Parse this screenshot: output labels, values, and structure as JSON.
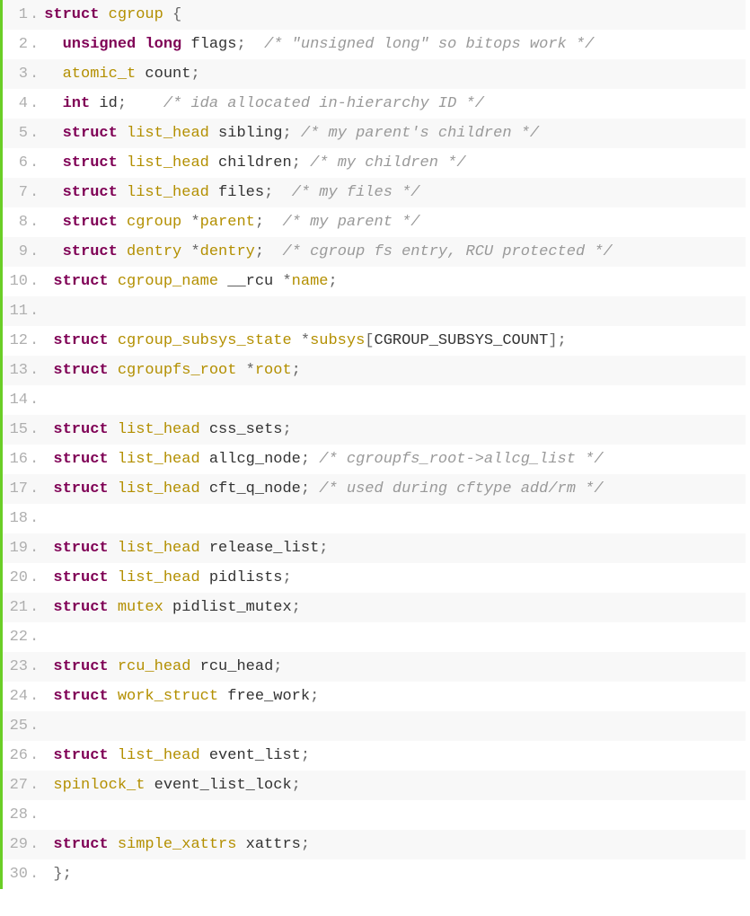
{
  "code": {
    "lines": [
      {
        "n": 1,
        "tokens": [
          {
            "t": "struct",
            "c": "kw"
          },
          {
            "t": " "
          },
          {
            "t": "cgroup",
            "c": "tname"
          },
          {
            "t": " "
          },
          {
            "t": "{",
            "c": "pun"
          }
        ]
      },
      {
        "n": 2,
        "tokens": [
          {
            "t": "  "
          },
          {
            "t": "unsigned",
            "c": "kw"
          },
          {
            "t": " "
          },
          {
            "t": "long",
            "c": "kw"
          },
          {
            "t": " flags"
          },
          {
            "t": ";",
            "c": "pun"
          },
          {
            "t": "  "
          },
          {
            "t": "/* \"unsigned long\" so bitops work */",
            "c": "cmt"
          }
        ]
      },
      {
        "n": 3,
        "tokens": [
          {
            "t": "  "
          },
          {
            "t": "atomic_t",
            "c": "tname"
          },
          {
            "t": " count"
          },
          {
            "t": ";",
            "c": "pun"
          }
        ]
      },
      {
        "n": 4,
        "tokens": [
          {
            "t": "  "
          },
          {
            "t": "int",
            "c": "kw"
          },
          {
            "t": " id"
          },
          {
            "t": ";",
            "c": "pun"
          },
          {
            "t": "    "
          },
          {
            "t": "/* ida allocated in-hierarchy ID */",
            "c": "cmt"
          }
        ]
      },
      {
        "n": 5,
        "tokens": [
          {
            "t": "  "
          },
          {
            "t": "struct",
            "c": "kw"
          },
          {
            "t": " "
          },
          {
            "t": "list_head",
            "c": "tname"
          },
          {
            "t": " sibling"
          },
          {
            "t": ";",
            "c": "pun"
          },
          {
            "t": " "
          },
          {
            "t": "/* my parent's children */",
            "c": "cmt"
          }
        ]
      },
      {
        "n": 6,
        "tokens": [
          {
            "t": "  "
          },
          {
            "t": "struct",
            "c": "kw"
          },
          {
            "t": " "
          },
          {
            "t": "list_head",
            "c": "tname"
          },
          {
            "t": " children"
          },
          {
            "t": ";",
            "c": "pun"
          },
          {
            "t": " "
          },
          {
            "t": "/* my children */",
            "c": "cmt"
          }
        ]
      },
      {
        "n": 7,
        "tokens": [
          {
            "t": "  "
          },
          {
            "t": "struct",
            "c": "kw"
          },
          {
            "t": " "
          },
          {
            "t": "list_head",
            "c": "tname"
          },
          {
            "t": " files"
          },
          {
            "t": ";",
            "c": "pun"
          },
          {
            "t": "  "
          },
          {
            "t": "/* my files */",
            "c": "cmt"
          }
        ]
      },
      {
        "n": 8,
        "tokens": [
          {
            "t": "  "
          },
          {
            "t": "struct",
            "c": "kw"
          },
          {
            "t": " "
          },
          {
            "t": "cgroup",
            "c": "tname"
          },
          {
            "t": " "
          },
          {
            "t": "*",
            "c": "pun"
          },
          {
            "t": "parent",
            "c": "tname"
          },
          {
            "t": ";",
            "c": "pun"
          },
          {
            "t": "  "
          },
          {
            "t": "/* my parent */",
            "c": "cmt"
          }
        ]
      },
      {
        "n": 9,
        "tokens": [
          {
            "t": "  "
          },
          {
            "t": "struct",
            "c": "kw"
          },
          {
            "t": " "
          },
          {
            "t": "dentry",
            "c": "tname"
          },
          {
            "t": " "
          },
          {
            "t": "*",
            "c": "pun"
          },
          {
            "t": "dentry",
            "c": "tname"
          },
          {
            "t": ";",
            "c": "pun"
          },
          {
            "t": "  "
          },
          {
            "t": "/* cgroup fs entry, RCU protected */",
            "c": "cmt"
          }
        ]
      },
      {
        "n": 10,
        "tokens": [
          {
            "t": " "
          },
          {
            "t": "struct",
            "c": "kw"
          },
          {
            "t": " "
          },
          {
            "t": "cgroup_name",
            "c": "tname"
          },
          {
            "t": " __rcu "
          },
          {
            "t": "*",
            "c": "pun"
          },
          {
            "t": "name",
            "c": "tname"
          },
          {
            "t": ";",
            "c": "pun"
          }
        ]
      },
      {
        "n": 11,
        "tokens": [
          {
            "t": " "
          }
        ]
      },
      {
        "n": 12,
        "tokens": [
          {
            "t": " "
          },
          {
            "t": "struct",
            "c": "kw"
          },
          {
            "t": " "
          },
          {
            "t": "cgroup_subsys_state",
            "c": "tname"
          },
          {
            "t": " "
          },
          {
            "t": "*",
            "c": "pun"
          },
          {
            "t": "subsys",
            "c": "tname"
          },
          {
            "t": "[",
            "c": "pun"
          },
          {
            "t": "CGROUP_SUBSYS_COUNT"
          },
          {
            "t": "];",
            "c": "pun"
          }
        ]
      },
      {
        "n": 13,
        "tokens": [
          {
            "t": " "
          },
          {
            "t": "struct",
            "c": "kw"
          },
          {
            "t": " "
          },
          {
            "t": "cgroupfs_root",
            "c": "tname"
          },
          {
            "t": " "
          },
          {
            "t": "*",
            "c": "pun"
          },
          {
            "t": "root",
            "c": "tname"
          },
          {
            "t": ";",
            "c": "pun"
          }
        ]
      },
      {
        "n": 14,
        "tokens": [
          {
            "t": " "
          }
        ]
      },
      {
        "n": 15,
        "tokens": [
          {
            "t": " "
          },
          {
            "t": "struct",
            "c": "kw"
          },
          {
            "t": " "
          },
          {
            "t": "list_head",
            "c": "tname"
          },
          {
            "t": " css_sets"
          },
          {
            "t": ";",
            "c": "pun"
          }
        ]
      },
      {
        "n": 16,
        "tokens": [
          {
            "t": " "
          },
          {
            "t": "struct",
            "c": "kw"
          },
          {
            "t": " "
          },
          {
            "t": "list_head",
            "c": "tname"
          },
          {
            "t": " allcg_node"
          },
          {
            "t": ";",
            "c": "pun"
          },
          {
            "t": " "
          },
          {
            "t": "/* cgroupfs_root->allcg_list */",
            "c": "cmt"
          }
        ]
      },
      {
        "n": 17,
        "tokens": [
          {
            "t": " "
          },
          {
            "t": "struct",
            "c": "kw"
          },
          {
            "t": " "
          },
          {
            "t": "list_head",
            "c": "tname"
          },
          {
            "t": " cft_q_node"
          },
          {
            "t": ";",
            "c": "pun"
          },
          {
            "t": " "
          },
          {
            "t": "/* used during cftype add/rm */",
            "c": "cmt"
          }
        ]
      },
      {
        "n": 18,
        "tokens": [
          {
            "t": " "
          }
        ]
      },
      {
        "n": 19,
        "tokens": [
          {
            "t": " "
          },
          {
            "t": "struct",
            "c": "kw"
          },
          {
            "t": " "
          },
          {
            "t": "list_head",
            "c": "tname"
          },
          {
            "t": " release_list"
          },
          {
            "t": ";",
            "c": "pun"
          }
        ]
      },
      {
        "n": 20,
        "tokens": [
          {
            "t": " "
          },
          {
            "t": "struct",
            "c": "kw"
          },
          {
            "t": " "
          },
          {
            "t": "list_head",
            "c": "tname"
          },
          {
            "t": " pidlists"
          },
          {
            "t": ";",
            "c": "pun"
          }
        ]
      },
      {
        "n": 21,
        "tokens": [
          {
            "t": " "
          },
          {
            "t": "struct",
            "c": "kw"
          },
          {
            "t": " "
          },
          {
            "t": "mutex",
            "c": "tname"
          },
          {
            "t": " pidlist_mutex"
          },
          {
            "t": ";",
            "c": "pun"
          }
        ]
      },
      {
        "n": 22,
        "tokens": [
          {
            "t": " "
          }
        ]
      },
      {
        "n": 23,
        "tokens": [
          {
            "t": " "
          },
          {
            "t": "struct",
            "c": "kw"
          },
          {
            "t": " "
          },
          {
            "t": "rcu_head",
            "c": "tname"
          },
          {
            "t": " rcu_head"
          },
          {
            "t": ";",
            "c": "pun"
          }
        ]
      },
      {
        "n": 24,
        "tokens": [
          {
            "t": " "
          },
          {
            "t": "struct",
            "c": "kw"
          },
          {
            "t": " "
          },
          {
            "t": "work_struct",
            "c": "tname"
          },
          {
            "t": " free_work"
          },
          {
            "t": ";",
            "c": "pun"
          }
        ]
      },
      {
        "n": 25,
        "tokens": [
          {
            "t": " "
          }
        ]
      },
      {
        "n": 26,
        "tokens": [
          {
            "t": " "
          },
          {
            "t": "struct",
            "c": "kw"
          },
          {
            "t": " "
          },
          {
            "t": "list_head",
            "c": "tname"
          },
          {
            "t": " event_list"
          },
          {
            "t": ";",
            "c": "pun"
          }
        ]
      },
      {
        "n": 27,
        "tokens": [
          {
            "t": " "
          },
          {
            "t": "spinlock_t",
            "c": "tname"
          },
          {
            "t": " event_list_lock"
          },
          {
            "t": ";",
            "c": "pun"
          }
        ]
      },
      {
        "n": 28,
        "tokens": [
          {
            "t": " "
          }
        ]
      },
      {
        "n": 29,
        "tokens": [
          {
            "t": " "
          },
          {
            "t": "struct",
            "c": "kw"
          },
          {
            "t": " "
          },
          {
            "t": "simple_xattrs",
            "c": "tname"
          },
          {
            "t": " xattrs"
          },
          {
            "t": ";",
            "c": "pun"
          }
        ]
      },
      {
        "n": 30,
        "tokens": [
          {
            "t": " "
          },
          {
            "t": "};",
            "c": "pun"
          }
        ]
      }
    ]
  }
}
